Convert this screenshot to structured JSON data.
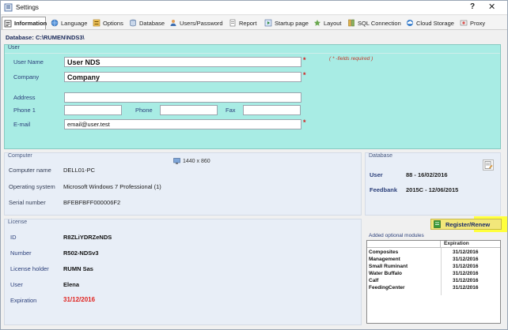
{
  "window": {
    "title": "Settings",
    "help_glyph": "?",
    "close_glyph": "✕"
  },
  "tabs": [
    {
      "label": "Information",
      "icon": "information-icon",
      "active": true
    },
    {
      "label": "Language",
      "icon": "globe-icon"
    },
    {
      "label": "Options",
      "icon": "options-icon"
    },
    {
      "label": "Database",
      "icon": "database-icon"
    },
    {
      "label": "Users/Password",
      "icon": "users-icon"
    },
    {
      "label": "Report",
      "icon": "report-icon"
    },
    {
      "label": "Startup page",
      "icon": "startup-icon"
    },
    {
      "label": "Layout",
      "icon": "layout-icon"
    },
    {
      "label": "SQL Connection",
      "icon": "sql-icon"
    },
    {
      "label": "Cloud Storage",
      "icon": "cloud-icon"
    },
    {
      "label": "Proxy",
      "icon": "proxy-icon"
    }
  ],
  "database_line": {
    "label": "Database:",
    "path": "C:\\RUMEN\\NDS3\\"
  },
  "user": {
    "header": "User",
    "required_note": "( * -fields required )",
    "user_name": {
      "label": "User Name",
      "value": "User NDS"
    },
    "company": {
      "label": "Company",
      "value": "Company"
    },
    "address": {
      "label": "Address",
      "value": ""
    },
    "phone1": {
      "label": "Phone 1",
      "value": ""
    },
    "phone": {
      "label": "Phone",
      "value": ""
    },
    "fax": {
      "label": "Fax",
      "value": ""
    },
    "email": {
      "label": "E-mail",
      "value": "email@user.test"
    },
    "required_mark": "*"
  },
  "computer": {
    "header": "Computer",
    "screen": "1440 x 860",
    "rows": [
      {
        "label": "Computer name",
        "value": "DELL01-PC"
      },
      {
        "label": "Operating system",
        "value": "Microsoft Windows 7 Professional   (1)"
      },
      {
        "label": "Serial number",
        "value": "BFEBFBFF000006F2"
      }
    ]
  },
  "database": {
    "header": "Database",
    "user_label": "User",
    "user_value": "88  -  16/02/2016",
    "feedbank_label": "Feedbank",
    "feedbank_value": "2015C  -  12/06/2015"
  },
  "license": {
    "header": "License",
    "rows": [
      {
        "label": "ID",
        "value": "R8ZLiYDRZeNDS"
      },
      {
        "label": "Number",
        "value": "R502-NDSv3"
      },
      {
        "label": "License holder",
        "value": "RUMN Sas"
      },
      {
        "label": "User",
        "value": "Elena"
      },
      {
        "label": "Expiration",
        "value": "31/12/2016"
      }
    ]
  },
  "register_button": "Register/Renew",
  "modules": {
    "header": "Added optional modules",
    "column": "Expiration",
    "rows": [
      {
        "name": "Composites",
        "expiration": "31/12/2016"
      },
      {
        "name": "Management",
        "expiration": "31/12/2016"
      },
      {
        "name": "Small Ruminant",
        "expiration": "31/12/2016"
      },
      {
        "name": "Water Buffalo",
        "expiration": "31/12/2016"
      },
      {
        "name": "Calf",
        "expiration": "31/12/2016"
      },
      {
        "name": "FeedingCenter",
        "expiration": "31/12/2016"
      }
    ]
  },
  "colors": {
    "user_panel": "#a8ece4",
    "accent_red": "#e0231f",
    "register_yellow": "#f2e77a",
    "highlight": "#ffff3c"
  }
}
